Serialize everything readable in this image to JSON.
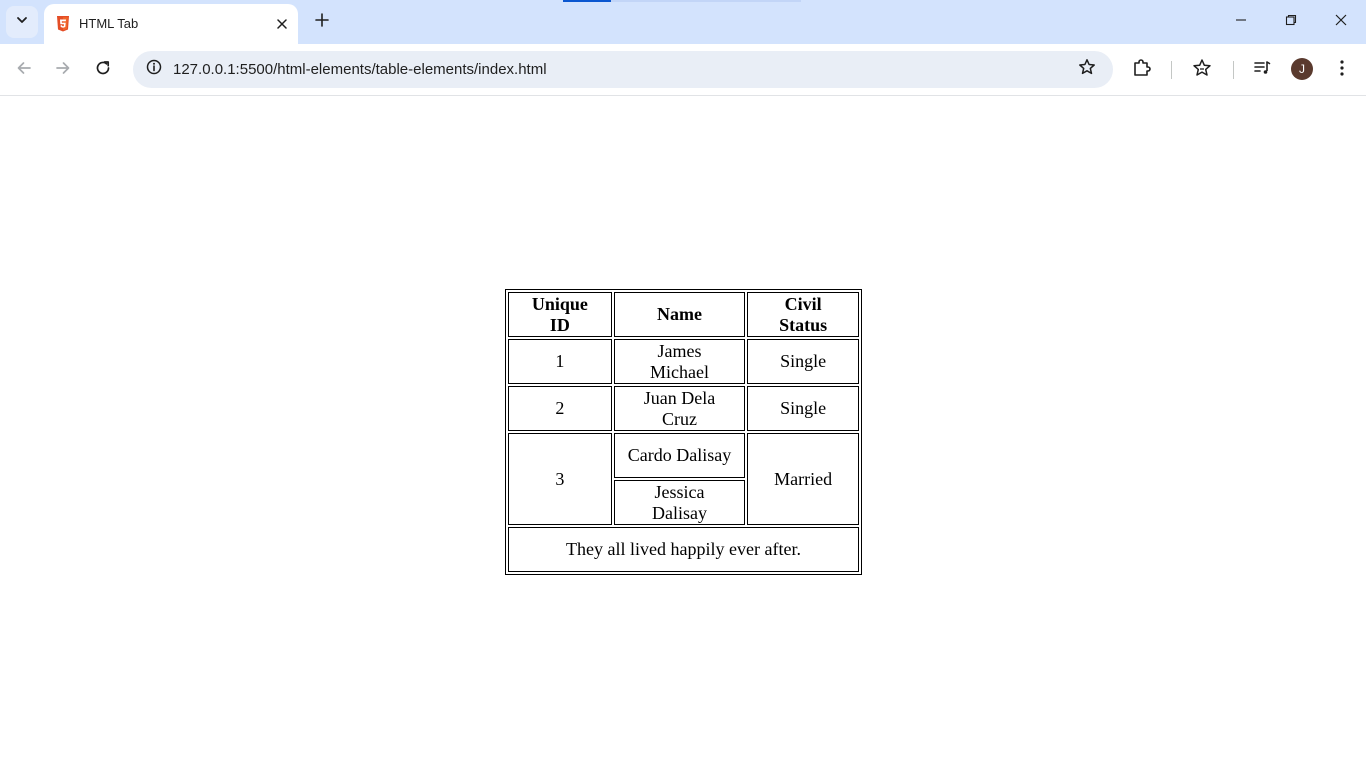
{
  "browser": {
    "tab_title": "HTML Tab",
    "url": "127.0.0.1:5500/html-elements/table-elements/index.html",
    "avatar_initial": "J",
    "accent_color": "#d3e3fd"
  },
  "icons": {
    "tab_search": "chevron-down-icon",
    "favicon": "html5-icon",
    "tab_close": "close-icon",
    "new_tab": "plus-icon",
    "back": "arrow-left-icon",
    "forward": "arrow-right-icon",
    "reload": "reload-icon",
    "site_info": "info-icon",
    "bookmark": "star-icon",
    "extensions": "puzzle-icon",
    "bookmarks_menu": "star-list-icon",
    "media": "media-queue-icon",
    "menu": "kebab-icon"
  },
  "table": {
    "headers": [
      "Unique ID",
      "Name",
      "Civil Status"
    ],
    "rows": [
      {
        "id": "1",
        "name": "James Michael",
        "status": "Single"
      },
      {
        "id": "2",
        "name": "Juan Dela Cruz",
        "status": "Single"
      },
      {
        "id": "3",
        "names": [
          "Cardo Dalisay",
          "Jessica Dalisay"
        ],
        "status": "Married"
      }
    ],
    "footer": "They all lived happily ever after."
  }
}
